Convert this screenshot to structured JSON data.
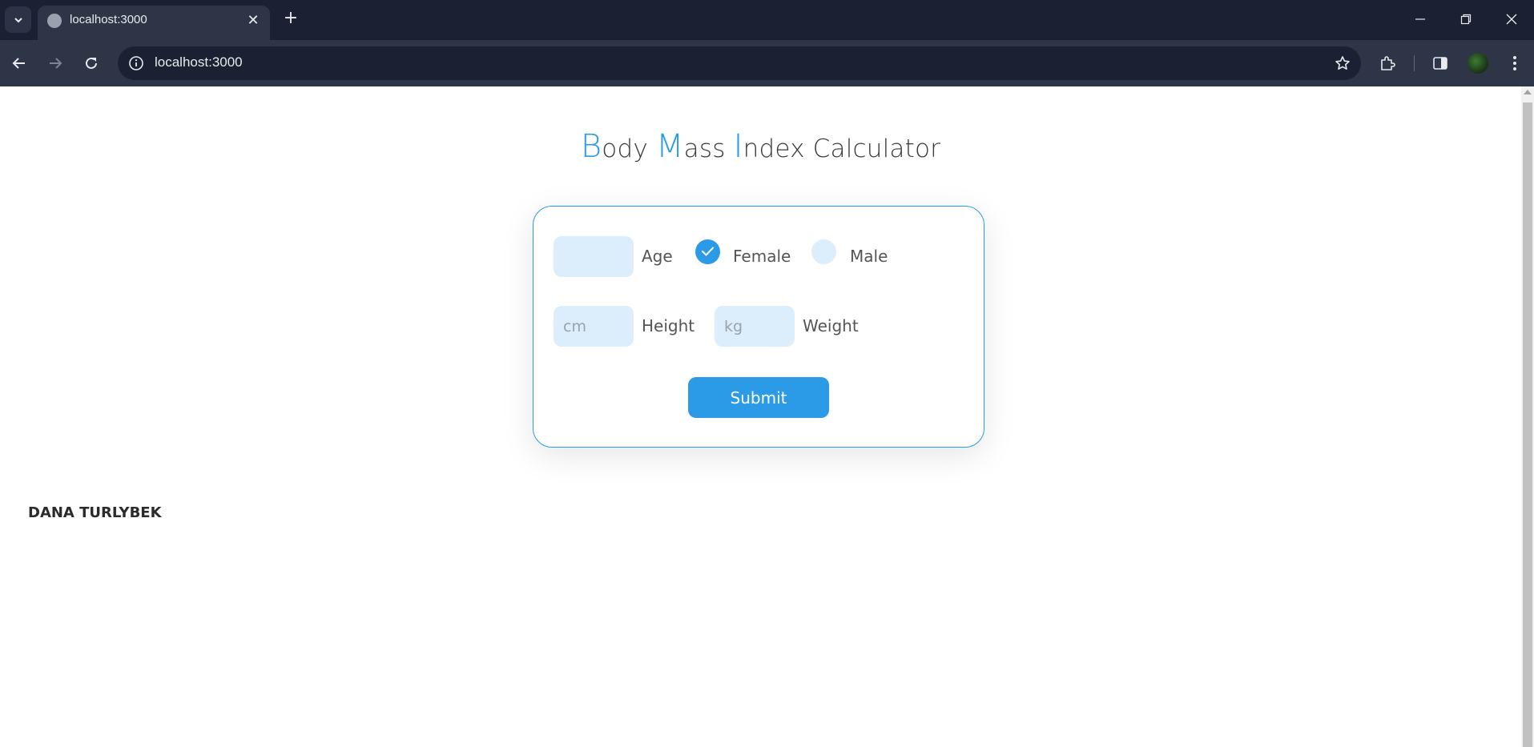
{
  "browser": {
    "tab_title": "localhost:3000",
    "url": "localhost:3000",
    "tab_close_glyph": "✕",
    "new_tab_glyph": "+"
  },
  "page": {
    "heading": {
      "b_cap": "B",
      "b_rest": "ody ",
      "m_cap": "M",
      "m_rest": "ass ",
      "i_cap": "I",
      "i_rest": "ndex Calculator"
    },
    "form": {
      "age_value": "",
      "age_label": "Age",
      "gender_options": [
        {
          "label": "Female",
          "checked": true
        },
        {
          "label": "Male",
          "checked": false
        }
      ],
      "height_placeholder": "cm",
      "height_label": "Height",
      "weight_placeholder": "kg",
      "weight_label": "Weight",
      "submit_label": "Submit"
    },
    "footer_name": "DANA TURLYBEK"
  },
  "colors": {
    "accent": "#2b9be8",
    "field_bg": "#dceefc",
    "chrome_dark": "#1b2133",
    "chrome_mid": "#2e3547"
  },
  "icons": [
    "tab-search-icon",
    "globe-icon",
    "close-icon",
    "plus-icon",
    "minimize-icon",
    "restore-icon",
    "window-close-icon",
    "back-icon",
    "forward-icon",
    "reload-icon",
    "info-icon",
    "star-icon",
    "extensions-icon",
    "side-panel-icon",
    "menu-icon",
    "checkmark-icon"
  ]
}
